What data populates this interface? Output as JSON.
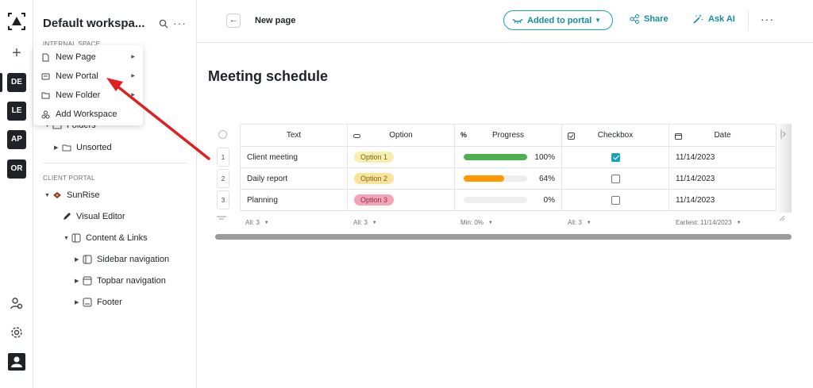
{
  "workspace": {
    "title": "Default workspa...",
    "rail_items": [
      "DE",
      "LE",
      "AP",
      "OR"
    ]
  },
  "sidebar": {
    "internal_label": "INTERNAL SPACE",
    "folders_label": "Folders",
    "unsorted_label": "Unsorted",
    "client_portal_label": "CLIENT PORTAL",
    "portal_name": "SunRise",
    "visual_editor": "Visual Editor",
    "content_links": "Content & Links",
    "children": [
      "Sidebar navigation",
      "Topbar navigation",
      "Footer"
    ]
  },
  "context_menu": {
    "items": [
      "New Page",
      "New Portal",
      "New Folder",
      "Add Workspace"
    ]
  },
  "topbar": {
    "page_name": "New page",
    "portal_status": "Added to portal",
    "share": "Share",
    "ask_ai": "Ask AI"
  },
  "document": {
    "title": "Meeting schedule"
  },
  "table": {
    "columns": [
      "Text",
      "Option",
      "Progress",
      "Checkbox",
      "Date"
    ],
    "rows": [
      {
        "num": "1",
        "text": "Client meeting",
        "option": "Option 1",
        "progress": 100,
        "progress_label": "100%",
        "checked": true,
        "date": "11/14/2023"
      },
      {
        "num": "2",
        "text": "Daily report",
        "option": "Option 2",
        "progress": 64,
        "progress_label": "64%",
        "checked": false,
        "date": "11/14/2023"
      },
      {
        "num": "3",
        "text": "Planning",
        "option": "Option 3",
        "progress": 0,
        "progress_label": "0%",
        "checked": false,
        "date": "11/14/2023"
      }
    ],
    "footer": [
      "All: 3",
      "All: 3",
      "Min: 0%",
      "All: 3",
      "Earliest: 11/14/2023"
    ]
  },
  "colors": {
    "accent": "#1aa3b8",
    "option1": "#f7efb0",
    "option2": "#f9e29a",
    "option3": "#f4a3b9",
    "progress_full": "#4caf50",
    "progress_partial": "#ff9800",
    "annotation_arrow": "#e02020"
  }
}
